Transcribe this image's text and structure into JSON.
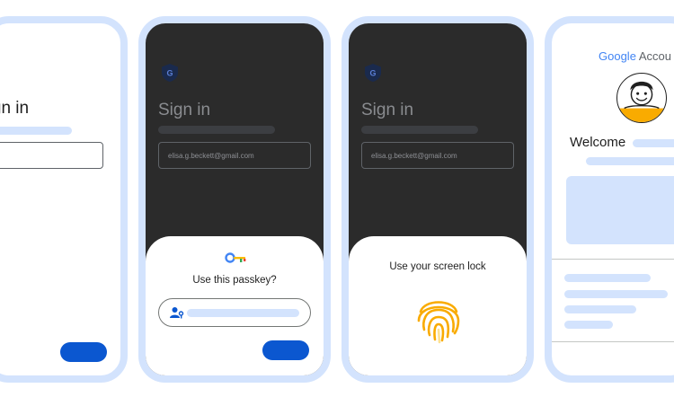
{
  "phones": [
    {
      "id": "phone-1",
      "name": "signin-screen-light"
    },
    {
      "id": "phone-2",
      "name": "passkey-prompt-screen"
    },
    {
      "id": "phone-3",
      "name": "screen-lock-screen"
    },
    {
      "id": "phone-4",
      "name": "google-account-welcome-screen"
    }
  ],
  "signin": {
    "title": "Sign in",
    "email": "elisa.g.beckett@gmail.com"
  },
  "passkey_sheet": {
    "title": "Use this passkey?"
  },
  "screen_lock_sheet": {
    "title": "Use your screen lock"
  },
  "welcome": {
    "brand_google": "Google",
    "brand_account": "Accou",
    "greeting": "Welcome"
  },
  "colors": {
    "frame": "#d3e3fd",
    "skeleton": "#d3e3fd",
    "primary_button": "#0b57d0",
    "dark_screen": "#2b2b2b",
    "fingerprint": "#f9ab00",
    "avatar_bg": "#f9ab00"
  },
  "icons": [
    "shield-g-icon",
    "passkey-key-icon",
    "person-key-icon",
    "fingerprint-icon",
    "avatar-icon"
  ]
}
